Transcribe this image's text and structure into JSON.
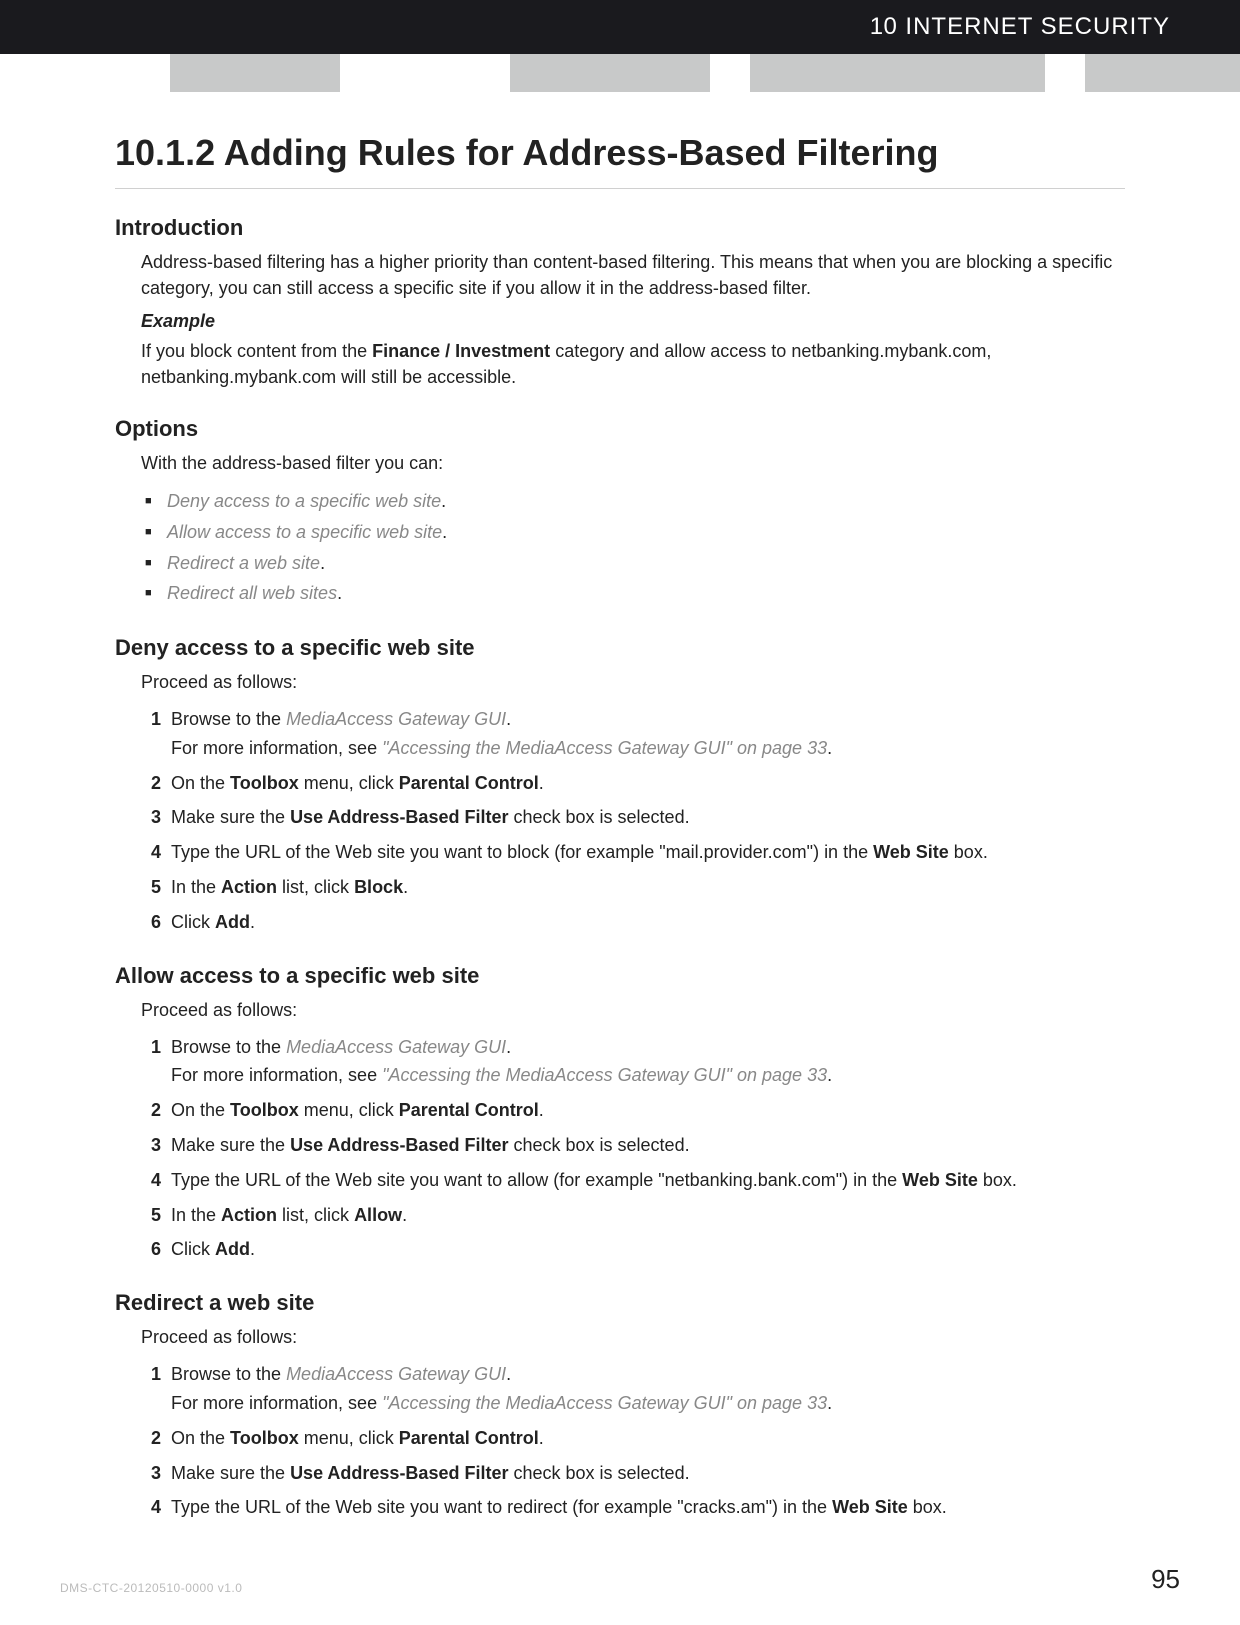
{
  "header": {
    "chapter_num": "10",
    "chapter_title": "INTERNET SECURITY"
  },
  "title": "10.1.2 Adding Rules for Address-Based Filtering",
  "intro": {
    "heading": "Introduction",
    "paragraph": "Address-based filtering has a higher priority than content-based filtering. This means that when you are blocking a specific category, you can still access a specific site if you allow it in the address-based filter.",
    "example_label": "Example",
    "example_pre": "If you block content from the ",
    "example_bold": "Finance / Investment",
    "example_post": " category and allow access to netbanking.mybank.com, netbanking.mybank.com will still be accessible."
  },
  "options": {
    "heading": "Options",
    "lead": "With the address-based filter you can:",
    "items": [
      "Deny access to a specific web site",
      "Allow access to a specific web site",
      "Redirect a web site",
      "Redirect all web sites"
    ]
  },
  "common": {
    "proceed": "Proceed as follows:",
    "browse_pre": "Browse to the ",
    "browse_link": "MediaAccess Gateway GUI",
    "moreinfo_pre": "For more information, see ",
    "moreinfo_link": "\"Accessing the MediaAccess Gateway GUI\" on page 33",
    "step2_pre": "On the ",
    "step2_b1": "Toolbox",
    "step2_mid": " menu, click ",
    "step2_b2": "Parental Control",
    "step3_pre": "Make sure the ",
    "step3_b": "Use Address-Based Filter",
    "step3_post": " check box is selected.",
    "website_b": "Web Site",
    "action_pre": "In the ",
    "action_b1": "Action",
    "action_mid": " list, click ",
    "click_pre": "Click ",
    "add_b": "Add"
  },
  "deny": {
    "heading": "Deny access to a specific web site",
    "url_sentence_pre": "Type the URL of the Web site you want to block (for example \"mail.provider.com\") in the ",
    "url_sentence_post": " box.",
    "action_value": "Block"
  },
  "allow": {
    "heading": "Allow access to a specific web site",
    "url_sentence_pre": "Type the URL of the Web site you want to allow (for example \"netbanking.bank.com\") in the ",
    "url_sentence_post": " box.",
    "action_value": "Allow"
  },
  "redirect": {
    "heading": "Redirect a web site",
    "url_sentence_pre": "Type the URL of the Web site you want to redirect (for example \"cracks.am\") in the ",
    "url_sentence_post": " box."
  },
  "footer": {
    "docid": "DMS-CTC-20120510-0000 v1.0",
    "pagenum": "95"
  }
}
